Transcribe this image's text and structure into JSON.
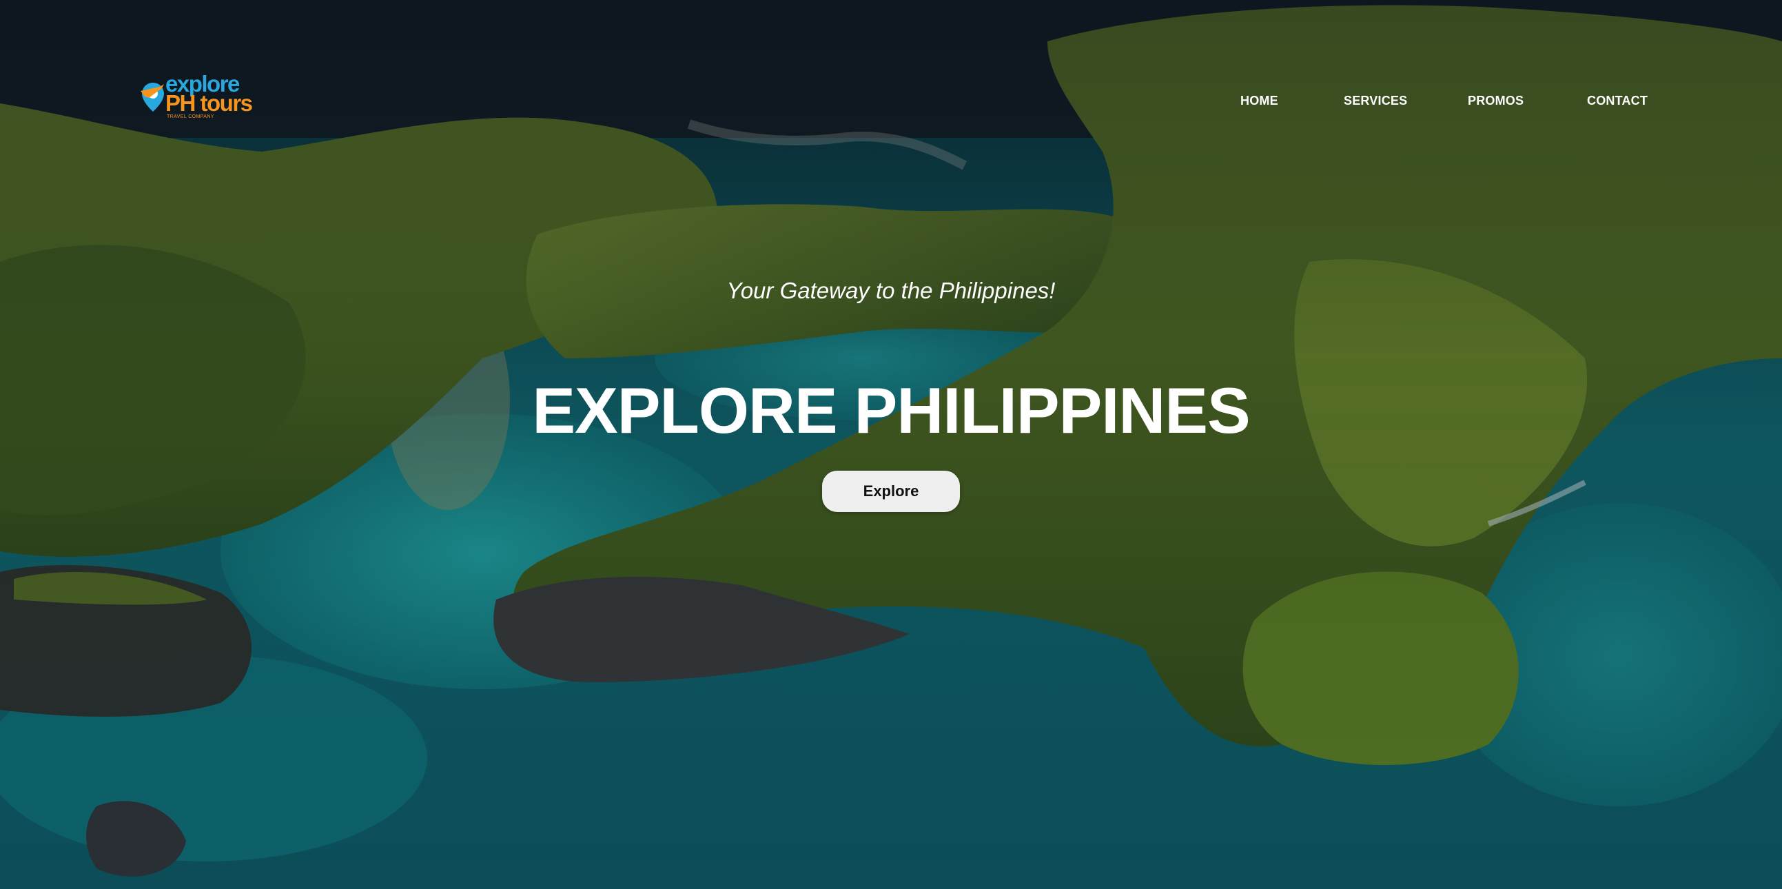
{
  "logo": {
    "line1": "explore",
    "line2": "PH tours",
    "tagline": "TRAVEL COMPANY",
    "colors": {
      "blue": "#29a8e0",
      "orange": "#f7941d"
    }
  },
  "nav": {
    "items": [
      {
        "label": "HOME"
      },
      {
        "label": "SERVICES"
      },
      {
        "label": "PROMOS"
      },
      {
        "label": "CONTACT"
      }
    ]
  },
  "hero": {
    "subtitle": "Your Gateway to the Philippines!",
    "title": "EXPLORE PHILIPPINES",
    "cta_label": "Explore",
    "background": "aerial-islands-lagoon-photo"
  }
}
